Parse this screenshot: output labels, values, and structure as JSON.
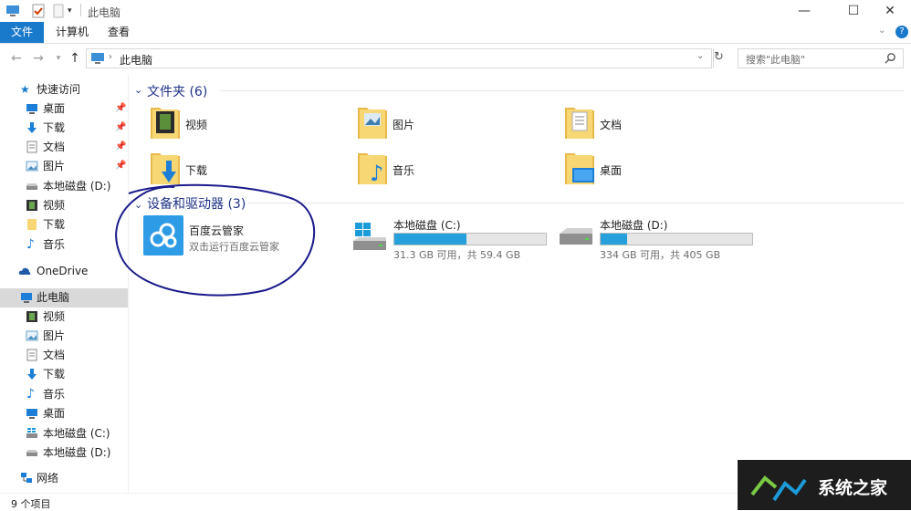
{
  "window": {
    "title": "此电脑"
  },
  "window_controls": {
    "minimize": "—",
    "maximize": "☐",
    "close": "✕"
  },
  "ribbon": {
    "tabs": [
      {
        "label": "文件",
        "active": true
      },
      {
        "label": "计算机",
        "active": false
      },
      {
        "label": "查看",
        "active": false
      }
    ],
    "help": "?"
  },
  "address": {
    "path": "此电脑"
  },
  "search": {
    "placeholder": "搜索\"此电脑\""
  },
  "nav": {
    "quick_access": "快速访问",
    "quick_items": [
      {
        "label": "桌面",
        "icon": "desktop-icon"
      },
      {
        "label": "下载",
        "icon": "download-icon"
      },
      {
        "label": "文档",
        "icon": "document-icon"
      },
      {
        "label": "图片",
        "icon": "picture-icon"
      },
      {
        "label": "本地磁盘 (D:)",
        "icon": "drive-icon"
      },
      {
        "label": "视频",
        "icon": "video-icon"
      },
      {
        "label": "下载",
        "icon": "folder-icon"
      },
      {
        "label": "音乐",
        "icon": "music-icon"
      }
    ],
    "onedrive": "OneDrive",
    "this_pc": "此电脑",
    "pc_items": [
      {
        "label": "视频",
        "icon": "video-icon"
      },
      {
        "label": "图片",
        "icon": "picture-icon"
      },
      {
        "label": "文档",
        "icon": "document-icon"
      },
      {
        "label": "下载",
        "icon": "download-icon"
      },
      {
        "label": "音乐",
        "icon": "music-icon"
      },
      {
        "label": "桌面",
        "icon": "desktop-icon"
      },
      {
        "label": "本地磁盘 (C:)",
        "icon": "windows-drive-icon"
      },
      {
        "label": "本地磁盘 (D:)",
        "icon": "drive-icon"
      }
    ],
    "network": "网络"
  },
  "folders_group": {
    "header": "文件夹 (6)"
  },
  "folders": [
    {
      "label": "视频",
      "icon": "video-folder-icon"
    },
    {
      "label": "图片",
      "icon": "picture-folder-icon"
    },
    {
      "label": "文档",
      "icon": "document-folder-icon"
    },
    {
      "label": "下载",
      "icon": "download-folder-icon"
    },
    {
      "label": "音乐",
      "icon": "music-folder-icon"
    },
    {
      "label": "桌面",
      "icon": "desktop-folder-icon"
    }
  ],
  "devices_group": {
    "header": "设备和驱动器 (3)"
  },
  "app_device": {
    "name": "百度云管家",
    "desc": "双击运行百度云管家"
  },
  "drives": [
    {
      "name": "本地磁盘 (C:)",
      "info": "31.3 GB 可用，共 59.4 GB",
      "used_fraction": 0.473
    },
    {
      "name": "本地磁盘 (D:)",
      "info": "334 GB 可用，共 405 GB",
      "used_fraction": 0.175
    }
  ],
  "status": {
    "count": "9 个项目"
  },
  "watermark": {
    "text": "系统之家"
  },
  "colors": {
    "accent": "#1979ca",
    "drive_fill": "#26a0da",
    "annotation": "#1a1a8c"
  }
}
